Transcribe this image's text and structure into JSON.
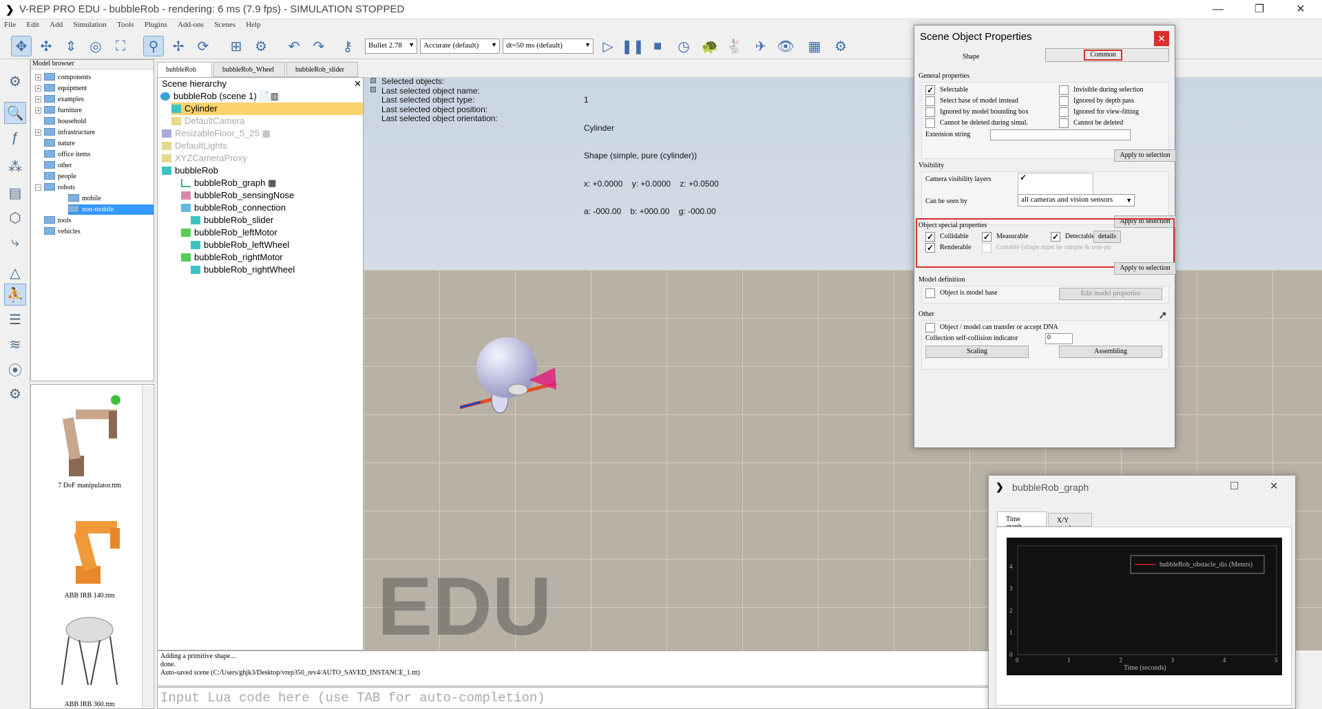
{
  "window": {
    "title": "V-REP PRO EDU - bubbleRob - rendering: 6 ms (7.9 fps) - SIMULATION STOPPED",
    "minimize": "—",
    "maximize": "❐",
    "close": "✕"
  },
  "menu": [
    "File",
    "Edit",
    "Add",
    "Simulation",
    "Tools",
    "Plugins",
    "Add-ons",
    "Scenes",
    "Help"
  ],
  "toolbar": {
    "engine": "Bullet 2.78",
    "accuracy": "Accurate (default)",
    "dt": "dt=50 ms (default)"
  },
  "model_browser": {
    "title": "Model browser",
    "folders": [
      "components",
      "equipment",
      "examples",
      "furniture",
      "household",
      "infrastructure",
      "nature",
      "office items",
      "other",
      "people",
      "robots",
      "mobile",
      "non-mobile",
      "tools",
      "vehicles"
    ]
  },
  "thumbnails": [
    "7 DoF manipulator.ttm",
    "ABB IRB 140.ttm",
    "ABB IRB 360.ttm"
  ],
  "scene_tabs": [
    "bubbleRob",
    "bubbleRob_Wheel",
    "bubbleRob_slider"
  ],
  "hierarchy": {
    "title": "Scene hierarchy",
    "items": [
      "bubbleRob (scene 1)",
      "Cylinder",
      "DefaultCamera",
      "ResizableFloor_5_25",
      "DefaultLights",
      "XYZCameraProxy",
      "bubbleRob",
      "bubbleRob_graph",
      "bubbleRob_sensingNose",
      "bubbleRob_connection",
      "bubbleRob_slider",
      "bubbleRob_leftMotor",
      "bubbleRob_leftWheel",
      "bubbleRob_rightMotor",
      "bubbleRob_rightWheel"
    ]
  },
  "info": {
    "labels": [
      "Selected objects:",
      "Last selected object name:",
      "Last selected object type:",
      "Last selected object position:",
      "Last selected object orientation:"
    ],
    "values": [
      "1",
      "Cylinder",
      "Shape (simple, pure (cylinder))",
      "x: +0.0000    y: +0.0000    z: +0.0500",
      "a: -000.00    b: +000.00    g: -000.00"
    ]
  },
  "watermark": "EDU",
  "console": [
    "Adding a primitive shape...",
    "done.",
    "Auto-saved scene (C:/Users/ghjk3/Desktop/vrep350_rev4/AUTO_SAVED_INSTANCE_1.ttt)"
  ],
  "lua_placeholder": "Input Lua code here (use TAB for auto-completion)",
  "props": {
    "title": "Scene Object Properties",
    "close": "✕",
    "tab_shape": "Shape",
    "tab_common": "Common",
    "general": {
      "title": "General properties",
      "selectable": "Selectable",
      "invisible": "Invisible during selection",
      "select_base": "Select base of model instead",
      "ignored_depth": "Ignored by depth pass",
      "ignored_bbox": "Ignored by model bounding  box",
      "ignored_view": "Ignored for view-fitting",
      "cannot_delete_sim": "Cannot be deleted during simul.",
      "cannot_delete": "Cannot be deleted",
      "ext_string": "Extension string",
      "apply": "Apply to selection"
    },
    "visibility": {
      "title": "Visibility",
      "layers": "Camera visibility layers",
      "seen_by": "Can be seen by",
      "seen_value": "all cameras and vision sensors",
      "apply": "Apply to selection"
    },
    "special": {
      "title": "Object special properties",
      "collidable": "Collidable",
      "measurable": "Measurable",
      "detectable": "Detectable",
      "details": "details",
      "renderable": "Renderable",
      "cuttable": "Cuttable (shape must be simple & non-pu",
      "apply": "Apply to selection"
    },
    "model": {
      "title": "Model definition",
      "base": "Object is model base",
      "edit": "Edit model properties"
    },
    "other": {
      "title": "Other",
      "dna": "Object / model can transfer or accept DNA",
      "collection": "Collection self-collision indicator",
      "collection_value": "0",
      "scaling": "Scaling",
      "assembling": "Assembling"
    }
  },
  "graph": {
    "title": "bubbleRob_graph",
    "tab_time": "Time graph",
    "tab_xy": "X/Y graph",
    "legend": "bubbleRob_obstacle_dis (Meters)",
    "xlabel": "Time (seconds)",
    "yticks": [
      "0",
      "1",
      "2",
      "3",
      "4"
    ],
    "xticks": [
      "0",
      "1",
      "2",
      "3",
      "4",
      "5"
    ]
  },
  "colors": {
    "accent": "#3399ff",
    "highlight": "#d9302c",
    "selection": "#fcd26c"
  }
}
